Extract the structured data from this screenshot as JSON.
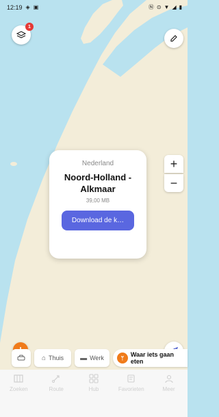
{
  "status_bar": {
    "time": "12:19",
    "left_icons": [
      "wifi-alt-icon",
      "message-icon"
    ],
    "right_icons": [
      "nfc-icon",
      "location-icon",
      "wifi-icon",
      "signal-icon",
      "battery-icon"
    ]
  },
  "map": {
    "water_color": "#b9e2ef",
    "land_color": "#f3edd9",
    "layers_badge": "1"
  },
  "download_card": {
    "country": "Nederland",
    "region": "Noord-Holland - Alkmaar",
    "size": "39,00 MB",
    "button_label": "Download de k…",
    "button_color": "#5a67e0"
  },
  "zoom": {
    "in": "+",
    "out": "−"
  },
  "shortcuts": {
    "home": "Thuis",
    "work": "Werk",
    "eat": "Waar iets gaan eten"
  },
  "bottom_nav": [
    {
      "label": "Zoeken",
      "icon": "map-search-icon"
    },
    {
      "label": "Route",
      "icon": "route-icon"
    },
    {
      "label": "Hub",
      "icon": "grid-icon"
    },
    {
      "label": "Favorieten",
      "icon": "bookmark-icon"
    },
    {
      "label": "Meer",
      "icon": "more-icon"
    }
  ]
}
